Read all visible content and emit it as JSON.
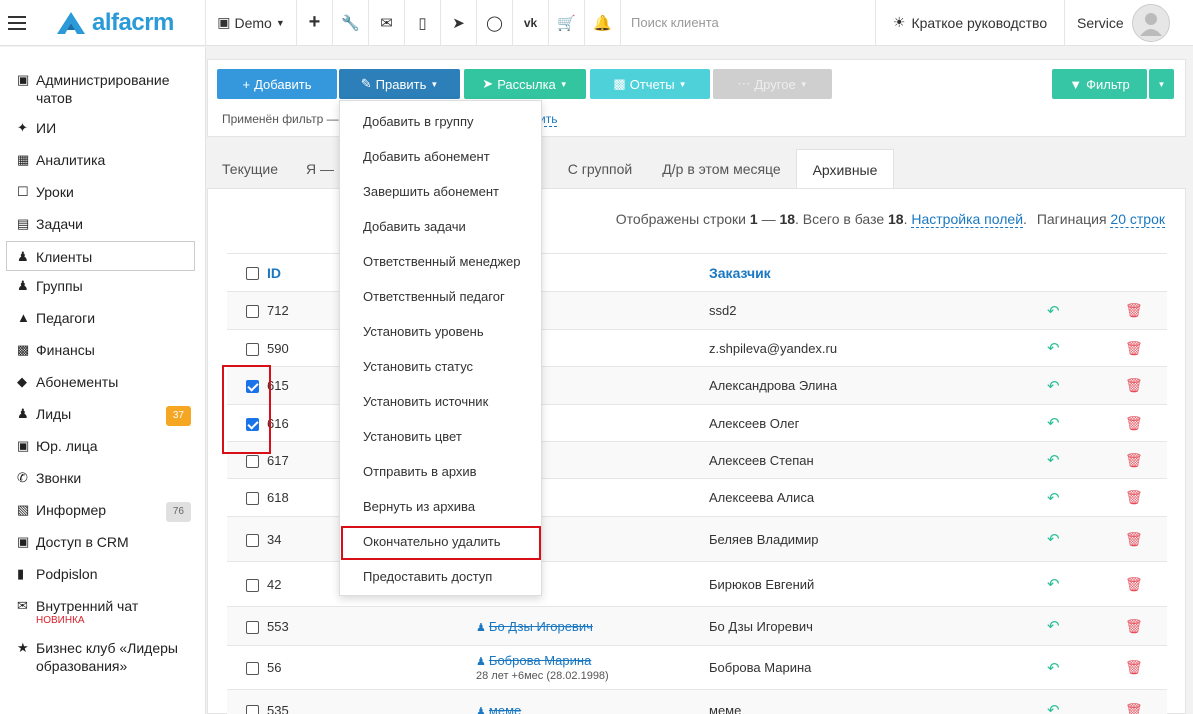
{
  "topbar": {
    "logo_text": "alfacrm",
    "demo_label": "Demo",
    "search_placeholder": "Поиск клиента",
    "guide_label": "Краткое руководство",
    "user_label": "Service"
  },
  "sidebar": {
    "items": [
      {
        "label": "Администрирование чатов",
        "icon": "chat-admin-icon"
      },
      {
        "label": "ИИ",
        "icon": "sparkle-icon"
      },
      {
        "label": "Аналитика",
        "icon": "map-icon"
      },
      {
        "label": "Уроки",
        "icon": "calendar-icon"
      },
      {
        "label": "Задачи",
        "icon": "clipboard-icon"
      },
      {
        "label": "Клиенты",
        "icon": "user-icon"
      },
      {
        "label": "Группы",
        "icon": "users-icon"
      },
      {
        "label": "Педагоги",
        "icon": "graduation-icon"
      },
      {
        "label": "Финансы",
        "icon": "money-icon"
      },
      {
        "label": "Абонементы",
        "icon": "tag-icon"
      },
      {
        "label": "Лиды",
        "icon": "user-plus-icon",
        "badge": "37"
      },
      {
        "label": "Юр. лица",
        "icon": "briefcase-icon"
      },
      {
        "label": "Звонки",
        "icon": "phone-icon"
      },
      {
        "label": "Информер",
        "icon": "inbox-icon",
        "badge": "76"
      },
      {
        "label": "Доступ в CRM",
        "icon": "lock-icon"
      },
      {
        "label": "Podpislon",
        "icon": "document-icon"
      },
      {
        "label": "Внутренний чат",
        "icon": "envelope-icon",
        "tag": "НОВИНКА"
      },
      {
        "label": "Бизнес клуб «Лидеры образования»",
        "icon": "star-icon"
      }
    ]
  },
  "toolbar": {
    "add": "Добавить",
    "edit": "Править",
    "mailing": "Рассылка",
    "reports": "Отчеты",
    "other": "Другое",
    "filter": "Фильтр",
    "filter_note": "Применён фильтр —",
    "filter_link": "ить"
  },
  "tabs": [
    "Текущие",
    "Я — ",
    "С группой",
    "Д/р в этом месяце",
    "Архивные"
  ],
  "summary": {
    "prefix": "Отображены строки",
    "from": "1",
    "dash": "—",
    "to": "18",
    "total_text": ". Всего в базе",
    "total": "18",
    "fields_link": "Настройка полей",
    "pagination_label": "Пагинация",
    "pagination_link": "20 строк"
  },
  "table": {
    "columns": {
      "id": "ID",
      "customer": "Заказчик"
    },
    "rows": [
      {
        "id": "712",
        "name": "",
        "sub": "",
        "customer": "ssd2",
        "checked": false
      },
      {
        "id": "590",
        "name": "",
        "sub": "",
        "customer": "z.shpileva@yandex.ru",
        "checked": false
      },
      {
        "id": "615",
        "name": "",
        "sub": "",
        "customer": "Александрова Элина",
        "checked": true
      },
      {
        "id": "616",
        "name": "",
        "sub": "",
        "customer": "Алексеев Олег",
        "checked": true
      },
      {
        "id": "617",
        "name": "",
        "sub": "",
        "customer": "Алексеев Степан",
        "checked": false
      },
      {
        "id": "618",
        "name": "",
        "sub": "",
        "customer": "Алексеева Алиса",
        "checked": false
      },
      {
        "id": "34",
        "name": "",
        "sub": "",
        "customer": "Беляев Владимир",
        "checked": false
      },
      {
        "id": "42",
        "name": "",
        "sub": "",
        "customer": "Бирюков Евгений",
        "checked": false
      },
      {
        "id": "553",
        "name": "Бо Дзы Игоревич",
        "sub": "",
        "customer": "Бо Дзы Игоревич",
        "checked": false
      },
      {
        "id": "56",
        "name": "Боброва Марина",
        "sub": "28 лет +6мес (28.02.1998)",
        "customer": "Боброва Марина",
        "checked": false
      },
      {
        "id": "535",
        "name": "меме",
        "sub": "",
        "customer": "меме",
        "checked": false
      }
    ]
  },
  "dropdown": {
    "items": [
      "Добавить в группу",
      "Добавить абонемент",
      "Завершить абонемент",
      "Добавить задачи",
      "Ответственный менеджер",
      "Ответственный педагог",
      "Установить уровень",
      "Установить статус",
      "Установить источник",
      "Установить цвет",
      "Отправить в архив",
      "Вернуть из архива",
      "Окончательно удалить",
      "Предоставить доступ"
    ]
  },
  "colors": {
    "accent": "#3598dc",
    "highlight": "#d90f17",
    "badge_orange": "#f5a623"
  }
}
